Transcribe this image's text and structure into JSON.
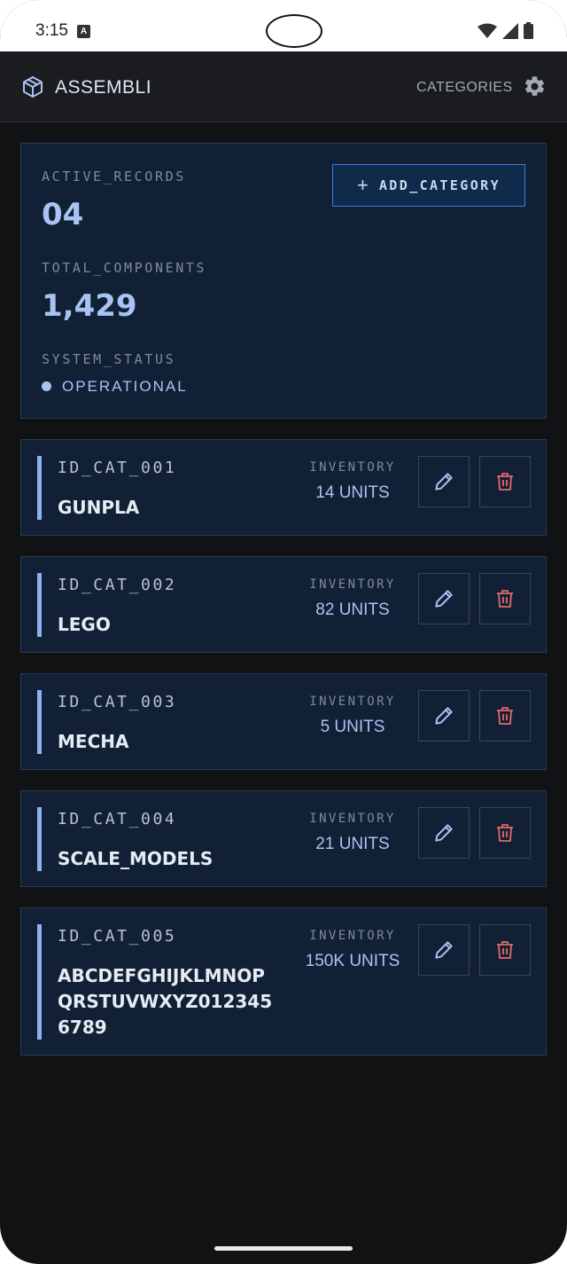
{
  "status_bar": {
    "time": "3:15",
    "badge": "A"
  },
  "app_bar": {
    "title": "ASSEMBLI",
    "nav_label": "CATEGORIES",
    "logo_icon": "cube-icon",
    "settings_icon": "gear-icon"
  },
  "summary": {
    "active_records_label": "ACTIVE_RECORDS",
    "active_records_value": "04",
    "total_components_label": "TOTAL_COMPONENTS",
    "total_components_value": "1,429",
    "system_status_label": "SYSTEM_STATUS",
    "system_status_value": "OPERATIONAL",
    "add_button_label": "ADD_CATEGORY"
  },
  "categories": [
    {
      "id": "ID_CAT_001",
      "name": "GUNPLA",
      "inventory_label": "INVENTORY",
      "inventory": "14 UNITS"
    },
    {
      "id": "ID_CAT_002",
      "name": "LEGO",
      "inventory_label": "INVENTORY",
      "inventory": "82 UNITS"
    },
    {
      "id": "ID_CAT_003",
      "name": "MECHA",
      "inventory_label": "INVENTORY",
      "inventory": "5 UNITS"
    },
    {
      "id": "ID_CAT_004",
      "name": "SCALE_MODELS",
      "inventory_label": "INVENTORY",
      "inventory": "21 UNITS"
    },
    {
      "id": "ID_CAT_005",
      "name": "ABCDEFGHIJKLMNOPQRSTUVWXYZ0123456789",
      "inventory_label": "INVENTORY",
      "inventory": "150K UNITS"
    }
  ],
  "colors": {
    "background": "#111214",
    "card": "#112034",
    "accent": "#a9c3f4",
    "button_border": "#3c7ce0",
    "delete": "#e26a6a"
  }
}
